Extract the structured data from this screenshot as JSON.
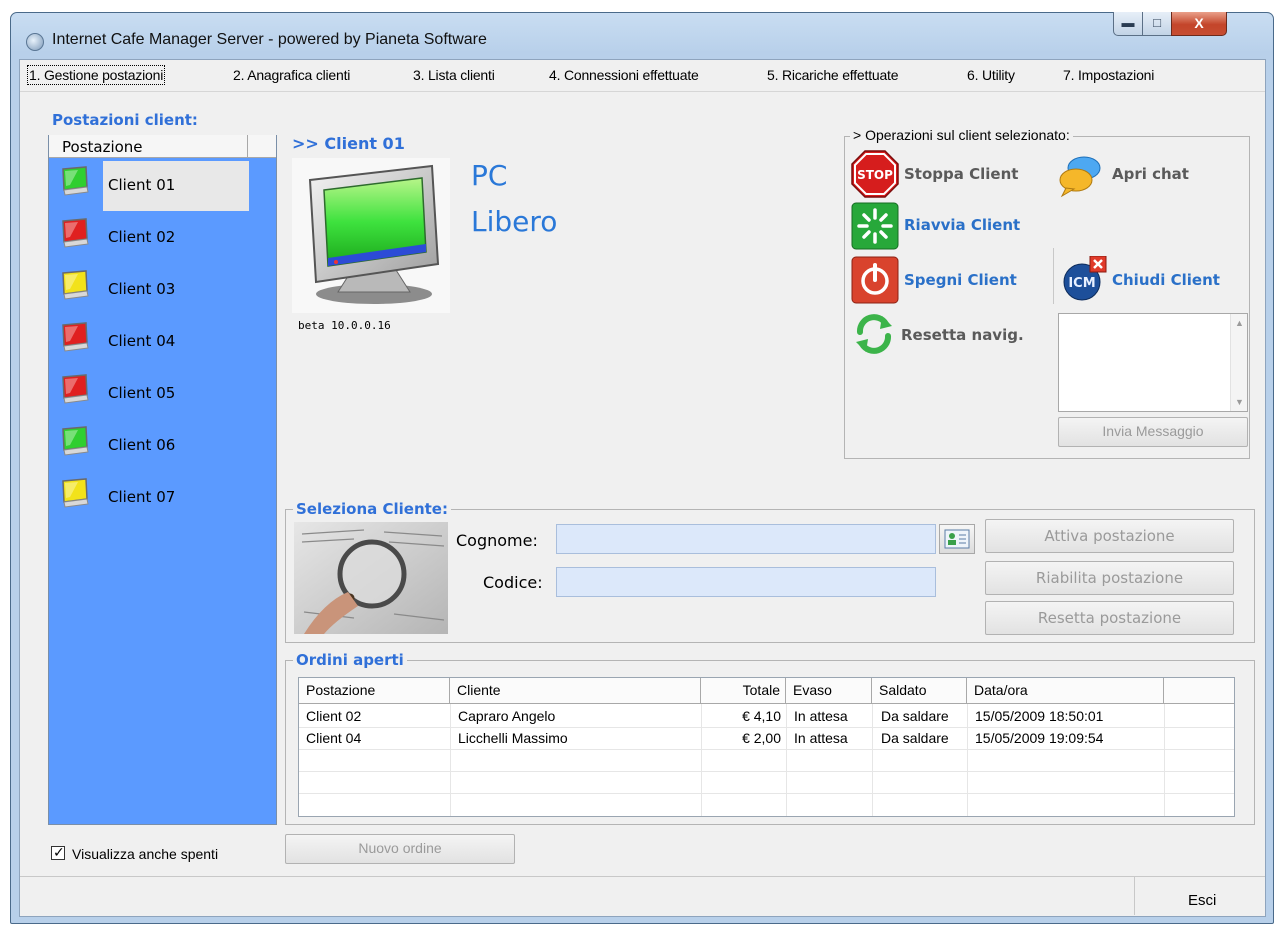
{
  "window": {
    "title": "Internet Cafe Manager Server - powered by Pianeta Software",
    "close_glyph": "X"
  },
  "menu": [
    {
      "label": "1. Gestione postazioni",
      "active": true
    },
    {
      "label": "2. Anagrafica clienti"
    },
    {
      "label": "3. Lista clienti"
    },
    {
      "label": "4. Connessioni effettuate"
    },
    {
      "label": "5. Ricariche effettuate"
    },
    {
      "label": "6. Utility"
    },
    {
      "label": "7. Impostazioni"
    }
  ],
  "client_list": {
    "title": "Postazioni client:",
    "column_header": "Postazione",
    "clients": [
      {
        "name": "Client 01",
        "color": "#2fcf2f",
        "selected": true
      },
      {
        "name": "Client 02",
        "color": "#e02020"
      },
      {
        "name": "Client 03",
        "color": "#f2e21a"
      },
      {
        "name": "Client 04",
        "color": "#e02020"
      },
      {
        "name": "Client 05",
        "color": "#e02020"
      },
      {
        "name": "Client 06",
        "color": "#2fcf2f"
      },
      {
        "name": "Client 07",
        "color": "#f2e21a"
      }
    ],
    "show_off_checkbox": {
      "label": "Visualizza anche spenti",
      "checked": true
    }
  },
  "selected_client": {
    "heading": ">> Client 01",
    "status_line1": "PC",
    "status_line2": "Libero",
    "version": "beta 10.0.0.16"
  },
  "operations": {
    "legend": "> Operazioni sul client selezionato:",
    "stop": "Stoppa Client",
    "stop_icon_text": "STOP",
    "chat": "Apri chat",
    "restart": "Riavvia Client",
    "shutdown": "Spegni Client",
    "close": "Chiudi Client",
    "close_icon_text": "ICM",
    "reset": "Resetta navig.",
    "send_message": "Invia Messaggio"
  },
  "select_customer": {
    "legend": "Seleziona Cliente:",
    "surname_label": "Cognome:",
    "surname_value": "",
    "code_label": "Codice:",
    "code_value": "",
    "activate": "Attiva postazione",
    "reenable": "Riabilita postazione",
    "reset": "Resetta postazione"
  },
  "orders": {
    "legend": "Ordini aperti",
    "columns": [
      "Postazione",
      "Cliente",
      "Totale",
      "Evaso",
      "Saldato",
      "Data/ora"
    ],
    "rows": [
      [
        "Client 02",
        "Capraro Angelo",
        "€ 4,10",
        "In attesa",
        "Da saldare",
        "15/05/2009 18:50:01"
      ],
      [
        "Client 04",
        "Licchelli Massimo",
        "€ 2,00",
        "In attesa",
        "Da saldare",
        "15/05/2009 19:09:54"
      ]
    ],
    "new_order": "Nuovo ordine"
  },
  "footer": {
    "exit": "Esci"
  },
  "colors": {
    "accent": "#3070d8",
    "list_background": "#5b9aff",
    "status_blue": "#2a78d8"
  }
}
